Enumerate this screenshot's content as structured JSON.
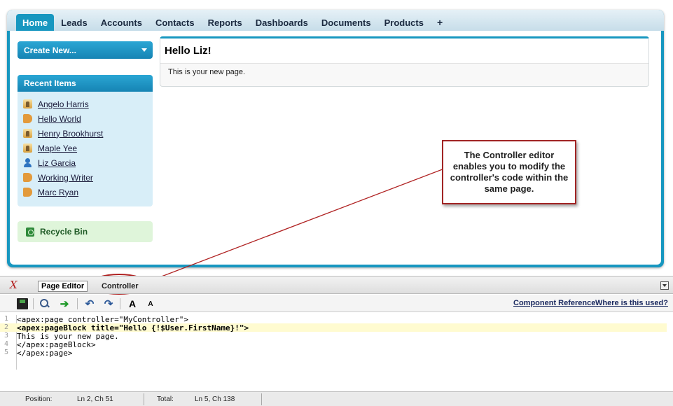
{
  "nav": {
    "tabs": [
      "Home",
      "Leads",
      "Accounts",
      "Contacts",
      "Reports",
      "Dashboards",
      "Documents",
      "Products",
      "+"
    ]
  },
  "sidebar": {
    "create_new": "Create New...",
    "recent_header": "Recent Items",
    "recent_items": [
      {
        "label": "Angelo Harris",
        "icon": "contact-icon"
      },
      {
        "label": "Hello World",
        "icon": "account-icon"
      },
      {
        "label": "Henry Brookhurst",
        "icon": "contact-icon"
      },
      {
        "label": "Maple Yee",
        "icon": "contact-icon"
      },
      {
        "label": "Liz Garcia",
        "icon": "user-icon"
      },
      {
        "label": "Working Writer",
        "icon": "account-icon"
      },
      {
        "label": "Marc Ryan",
        "icon": "account-icon"
      }
    ],
    "recycle_bin": "Recycle Bin"
  },
  "page_block": {
    "title": "Hello Liz!",
    "body": "This is your new page."
  },
  "callout": {
    "text": "The Controller editor enables you to modify the controller's code within the same page."
  },
  "editor": {
    "close_glyph": "X",
    "tabs": [
      "Page Editor",
      "Controller"
    ],
    "toolbar": {
      "font_large": "A",
      "font_small": "A",
      "component_reference": "Component Reference",
      "where_used": "Where is this used?"
    },
    "code_lines": [
      {
        "num": "1",
        "text": "<apex:page controller=\"MyController\">"
      },
      {
        "num": "2",
        "text": "<apex:pageBlock title=\"Hello {!$User.FirstName}!\">"
      },
      {
        "num": "3",
        "text": "This is your new page."
      },
      {
        "num": "4",
        "text": "</apex:pageBlock>"
      },
      {
        "num": "5",
        "text": "</apex:page>"
      }
    ],
    "highlight_line": 2
  },
  "status": {
    "position_label": "Position:",
    "position_value": "Ln 2, Ch 51",
    "total_label": "Total:",
    "total_value": "Ln 5, Ch 138"
  },
  "colors": {
    "brand_blue": "#1797c0",
    "callout_border": "#a12424",
    "highlight_line": "#fffbd0"
  }
}
